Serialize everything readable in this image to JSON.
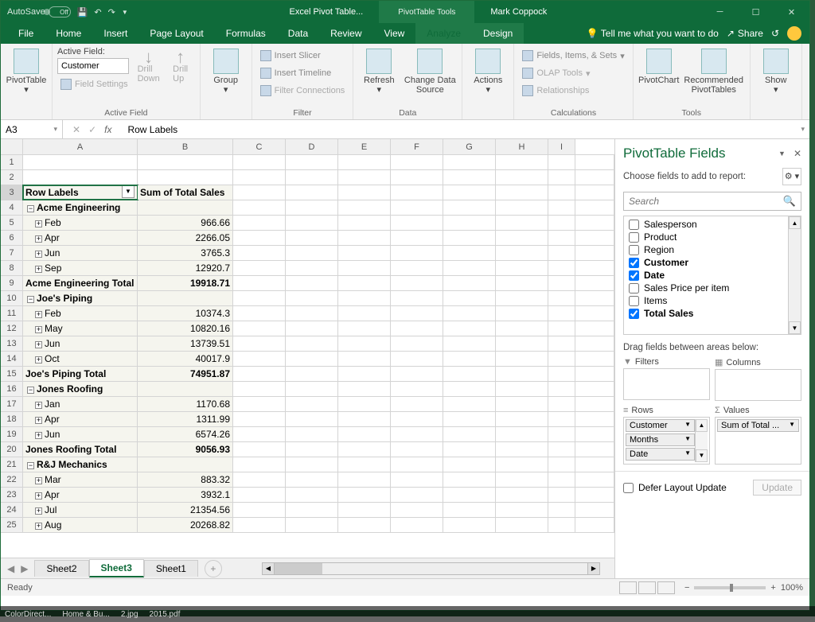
{
  "titlebar": {
    "autosave_label": "AutoSave",
    "autosave_state": "Off",
    "doc_name": "Excel Pivot Table...",
    "context_tool": "PivotTable Tools",
    "user": "Mark Coppock"
  },
  "tabs": {
    "file": "File",
    "home": "Home",
    "insert": "Insert",
    "page_layout": "Page Layout",
    "formulas": "Formulas",
    "data": "Data",
    "review": "Review",
    "view": "View",
    "analyze": "Analyze",
    "design": "Design",
    "tell_me": "Tell me what you want to do",
    "share": "Share"
  },
  "ribbon": {
    "pivottable": "PivotTable",
    "active_field_label": "Active Field:",
    "active_field_value": "Customer",
    "field_settings": "Field Settings",
    "drill_down": "Drill\nDown",
    "drill_up": "Drill\nUp",
    "group_active_field": "Active Field",
    "group": "Group",
    "insert_slicer": "Insert Slicer",
    "insert_timeline": "Insert Timeline",
    "filter_connections": "Filter Connections",
    "group_filter": "Filter",
    "refresh": "Refresh",
    "change_data_source": "Change Data\nSource",
    "group_data": "Data",
    "actions": "Actions",
    "fields_items_sets": "Fields, Items, & Sets",
    "olap_tools": "OLAP Tools",
    "relationships": "Relationships",
    "group_calc": "Calculations",
    "pivotchart": "PivotChart",
    "recommended": "Recommended\nPivotTables",
    "show": "Show",
    "group_tools": "Tools"
  },
  "formula": {
    "name_box": "A3",
    "value": "Row Labels"
  },
  "columns": [
    "A",
    "B",
    "C",
    "D",
    "E",
    "F",
    "G",
    "H",
    "I"
  ],
  "grid": {
    "headers": {
      "row_labels": "Row Labels",
      "sum_sales": "Sum of Total Sales"
    },
    "groups": [
      {
        "name": "Acme Engineering",
        "rows": [
          {
            "label": "Feb",
            "value": "966.66"
          },
          {
            "label": "Apr",
            "value": "2266.05"
          },
          {
            "label": "Jun",
            "value": "3765.3"
          },
          {
            "label": "Sep",
            "value": "12920.7"
          }
        ],
        "total_label": "Acme Engineering Total",
        "total": "19918.71"
      },
      {
        "name": "Joe's Piping",
        "rows": [
          {
            "label": "Feb",
            "value": "10374.3"
          },
          {
            "label": "May",
            "value": "10820.16"
          },
          {
            "label": "Jun",
            "value": "13739.51"
          },
          {
            "label": "Oct",
            "value": "40017.9"
          }
        ],
        "total_label": "Joe's Piping Total",
        "total": "74951.87"
      },
      {
        "name": "Jones Roofing",
        "rows": [
          {
            "label": "Jan",
            "value": "1170.68"
          },
          {
            "label": "Apr",
            "value": "1311.99"
          },
          {
            "label": "Jun",
            "value": "6574.26"
          }
        ],
        "total_label": "Jones Roofing Total",
        "total": "9056.93"
      },
      {
        "name": "R&J Mechanics",
        "rows": [
          {
            "label": "Mar",
            "value": "883.32"
          },
          {
            "label": "Apr",
            "value": "3932.1"
          },
          {
            "label": "Jul",
            "value": "21354.56"
          },
          {
            "label": "Aug",
            "value": "20268.82"
          }
        ]
      }
    ]
  },
  "sheet_tabs": {
    "sheet2": "Sheet2",
    "sheet3": "Sheet3",
    "sheet1": "Sheet1"
  },
  "field_pane": {
    "title": "PivotTable Fields",
    "choose": "Choose fields to add to report:",
    "search_placeholder": "Search",
    "fields": [
      {
        "label": "Salesperson",
        "checked": false,
        "bold": false
      },
      {
        "label": "Product",
        "checked": false,
        "bold": false
      },
      {
        "label": "Region",
        "checked": false,
        "bold": false
      },
      {
        "label": "Customer",
        "checked": true,
        "bold": true
      },
      {
        "label": "Date",
        "checked": true,
        "bold": true
      },
      {
        "label": "Sales Price per item",
        "checked": false,
        "bold": false
      },
      {
        "label": "Items",
        "checked": false,
        "bold": false
      },
      {
        "label": "Total Sales",
        "checked": true,
        "bold": true
      }
    ],
    "drag_hint": "Drag fields between areas below:",
    "filters_label": "Filters",
    "columns_label": "Columns",
    "rows_label": "Rows",
    "values_label": "Values",
    "rows_pills": [
      "Customer",
      "Months",
      "Date"
    ],
    "values_pills": [
      "Sum of Total ..."
    ],
    "defer": "Defer Layout Update",
    "update": "Update"
  },
  "status": {
    "ready": "Ready",
    "zoom": "100%"
  },
  "taskbar": [
    "ColorDirect...",
    "Home & Bu...",
    "2.jpg",
    "2015.pdf"
  ]
}
